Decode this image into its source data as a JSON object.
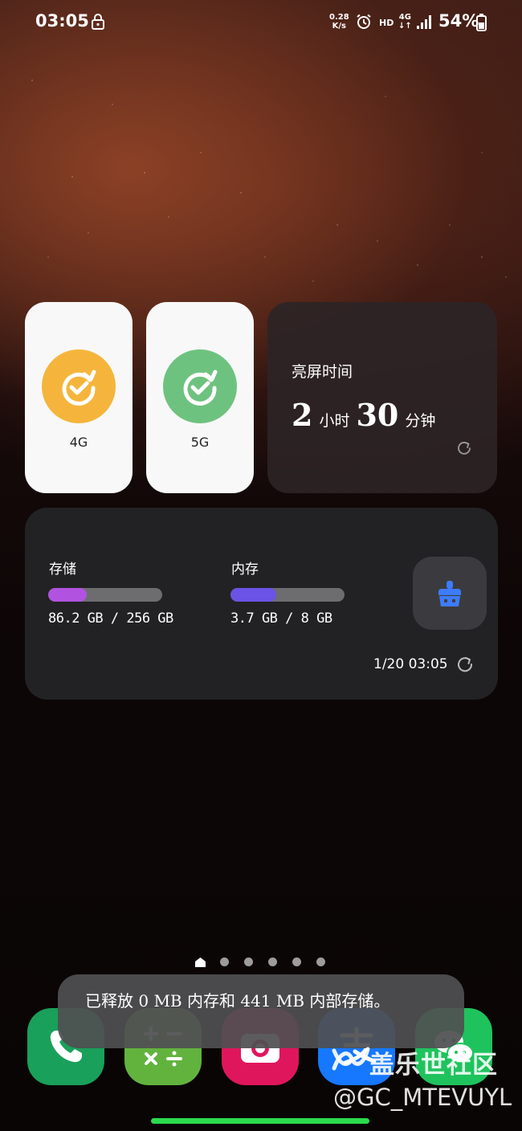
{
  "status_bar": {
    "time": "03:05",
    "net_speed_value": "0.28",
    "net_speed_unit": "K/s",
    "hd": "HD",
    "network": "4G",
    "battery": "54%",
    "icons": [
      "lock-icon",
      "alarm-icon",
      "signal-icon",
      "battery-icon"
    ]
  },
  "widgets": {
    "tile_4g": {
      "label": "4G",
      "color": "#f5b53c"
    },
    "tile_5g": {
      "label": "5G",
      "color": "#6ec27f"
    },
    "screen_time": {
      "title": "亮屏时间",
      "hours": "2",
      "hours_unit": "小时",
      "minutes": "30",
      "minutes_unit": "分钟"
    },
    "storage": {
      "storage_label": "存储",
      "storage_text": "86.2 GB / 256 GB",
      "storage_used_fraction": 0.337,
      "storage_color": "#b153e0",
      "memory_label": "内存",
      "memory_text": "3.7 GB / 8 GB",
      "memory_used_fraction": 0.4,
      "memory_color": "#6a53e6",
      "updated_time": "1/20 03:05"
    }
  },
  "pager": {
    "total_pages": 6,
    "current": 0
  },
  "dock": {
    "apps": [
      {
        "name": "phone",
        "color": "#19a05a"
      },
      {
        "name": "calculator",
        "color": "#62b33e"
      },
      {
        "name": "camera",
        "color": "#e0165c"
      },
      {
        "name": "alipay",
        "color": "#1677ff"
      },
      {
        "name": "wechat",
        "color": "#1fc35d"
      }
    ]
  },
  "toast": {
    "message": "已释放 0 MB 内存和 441 MB 内部存储。"
  },
  "watermark": {
    "brand": "盖乐世社区",
    "user": "@GC_MTEVUYL"
  }
}
